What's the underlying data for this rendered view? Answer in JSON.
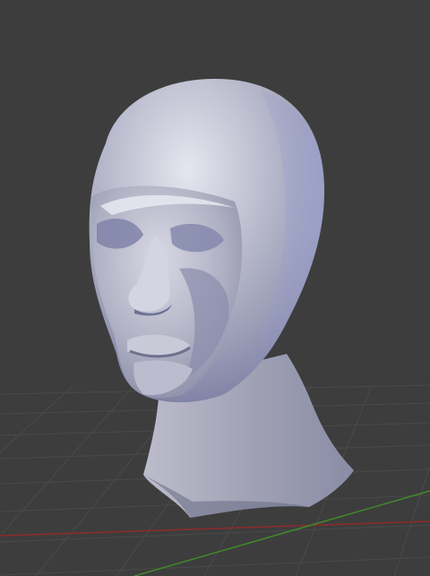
{
  "viewport": {
    "kind": "3d-viewport",
    "background": "#3d3d3d",
    "grid_color": "#4a4a4a",
    "x_axis_color": "#8f2a2a",
    "y_axis_color": "#3f8a2c"
  },
  "model": {
    "name": "sculpted-head-bust",
    "shading": "solid-matcap",
    "base_color": "#a7a8bd",
    "highlight_color": "#e4e4ee",
    "shadow_color": "#6e6f88",
    "rim_color": "#8e92c4"
  }
}
